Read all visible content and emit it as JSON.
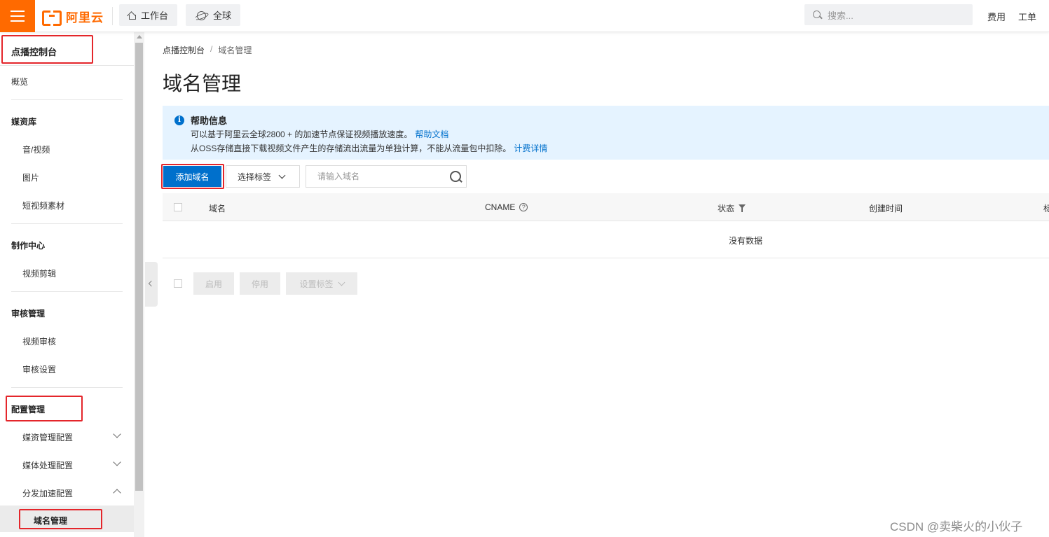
{
  "topbar": {
    "brand": "阿里云",
    "tabs": [
      {
        "label": "工作台",
        "icon": "home-icon"
      },
      {
        "label": "全球",
        "icon": "globe-icon"
      }
    ],
    "search_placeholder": "搜索...",
    "links": [
      "费用",
      "工单"
    ],
    "accent_color": "#ff6a00"
  },
  "sidebar": {
    "title": "点播控制台",
    "overview": "概览",
    "groups": [
      {
        "label": "媒资库",
        "items": [
          "音/视频",
          "图片",
          "短视频素材"
        ]
      },
      {
        "label": "制作中心",
        "items": [
          "视频剪辑"
        ]
      },
      {
        "label": "审核管理",
        "items": [
          "视频审核",
          "审核设置"
        ]
      },
      {
        "label": "配置管理",
        "items": [
          "媒资管理配置",
          "媒体处理配置",
          "分发加速配置"
        ],
        "active_child": "域名管理"
      }
    ]
  },
  "main": {
    "breadcrumb": [
      "点播控制台",
      "/",
      "域名管理"
    ],
    "title": "域名管理",
    "help": {
      "title": "帮助信息",
      "line1": "可以基于阿里云全球2800 + 的加速节点保证视频播放速度。",
      "line1_link": "帮助文档",
      "line2": "从OSS存储直接下载视频文件产生的存储流出流量为单独计算，不能从流量包中扣除。",
      "line2_link": "计费详情"
    },
    "toolbar": {
      "add_label": "添加域名",
      "select_tag_label": "选择标签",
      "domain_placeholder": "请输入域名"
    },
    "table": {
      "columns": [
        "域名",
        "CNAME",
        "状态",
        "创建时间",
        "标"
      ],
      "empty_text": "没有数据"
    },
    "batch": {
      "enable_label": "启用",
      "disable_label": "停用",
      "set_tag_label": "设置标签"
    },
    "primary_color": "#0070cc"
  },
  "watermark": "CSDN @卖柴火的小伙子"
}
